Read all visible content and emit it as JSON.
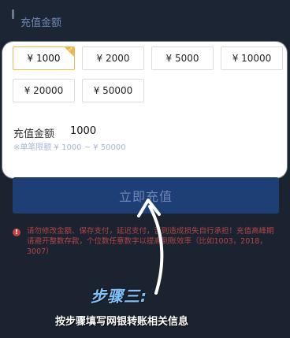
{
  "section": {
    "title": "充值金额"
  },
  "amounts": {
    "options": [
      {
        "label": "¥ 1000",
        "selected": true
      },
      {
        "label": "¥ 2000",
        "selected": false
      },
      {
        "label": "¥ 5000",
        "selected": false
      },
      {
        "label": "¥ 10000",
        "selected": false
      },
      {
        "label": "¥ 20000",
        "selected": false
      },
      {
        "label": "¥ 50000",
        "selected": false
      }
    ],
    "selected_check": "✓"
  },
  "amount_field": {
    "label": "充值金额",
    "value": "1000",
    "limit": "※单笔限额 ¥ 1000 ~ ¥ 50000"
  },
  "submit": {
    "label": "立即充值"
  },
  "warning": {
    "icon": "!",
    "text": "请勿修改金额、保存支付，延迟支付，否则造成损失自行承担！充值高峰期请避开整数存款，个位数任意数字以提高到账效率（比如1003，2018，3007）"
  },
  "overlay": {
    "step_title": "步骤三:",
    "step_desc": "按步骤填写网银转账相关信息"
  },
  "colors": {
    "accent": "#f0b74c",
    "submit_bg": "#1e3f76",
    "warning": "#b34747",
    "step_title": "#7fc2ff"
  }
}
